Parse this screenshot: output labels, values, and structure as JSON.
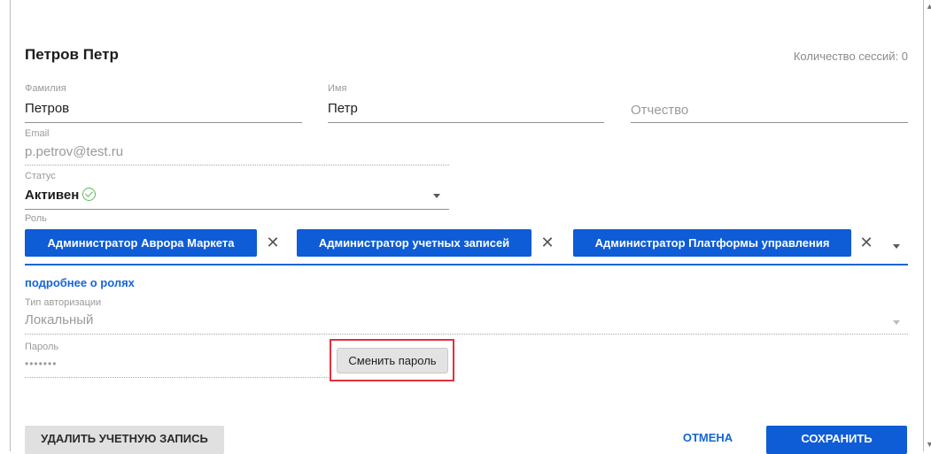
{
  "header": {
    "title": "Петров Петр",
    "sessions": "Количество сессий: 0"
  },
  "form": {
    "last_name": {
      "label": "Фамилия",
      "value": "Петров"
    },
    "first_name": {
      "label": "Имя",
      "value": "Петр"
    },
    "middle_name": {
      "placeholder": "Отчество"
    },
    "email": {
      "label": "Email",
      "value": "p.petrov@test.ru"
    },
    "status": {
      "label": "Статус",
      "value": "Активен",
      "icon": "check-circle-icon",
      "icon_color": "#5fb85f"
    },
    "role": {
      "label": "Роль",
      "chips": [
        "Администратор Аврора Маркета",
        "Администратор учетных записей",
        "Администратор Платформы управления"
      ],
      "remove_glyph": "✕",
      "details_link": "подробнее о ролях"
    },
    "auth_type": {
      "label": "Тип авторизации",
      "value": "Локальный"
    },
    "password": {
      "label": "Пароль",
      "value": "•••••••",
      "change_button": "Сменить пароль"
    }
  },
  "footer": {
    "delete_button": "УДАЛИТЬ УЧЕТНУЮ ЗАПИСЬ",
    "cancel_button": "ОТМЕНА",
    "save_button": "СОХРАНИТЬ"
  },
  "colors": {
    "accent": "#0e5cd6",
    "link": "#1565d8",
    "highlight": "#e0323c",
    "status_ok": "#5fb85f"
  }
}
